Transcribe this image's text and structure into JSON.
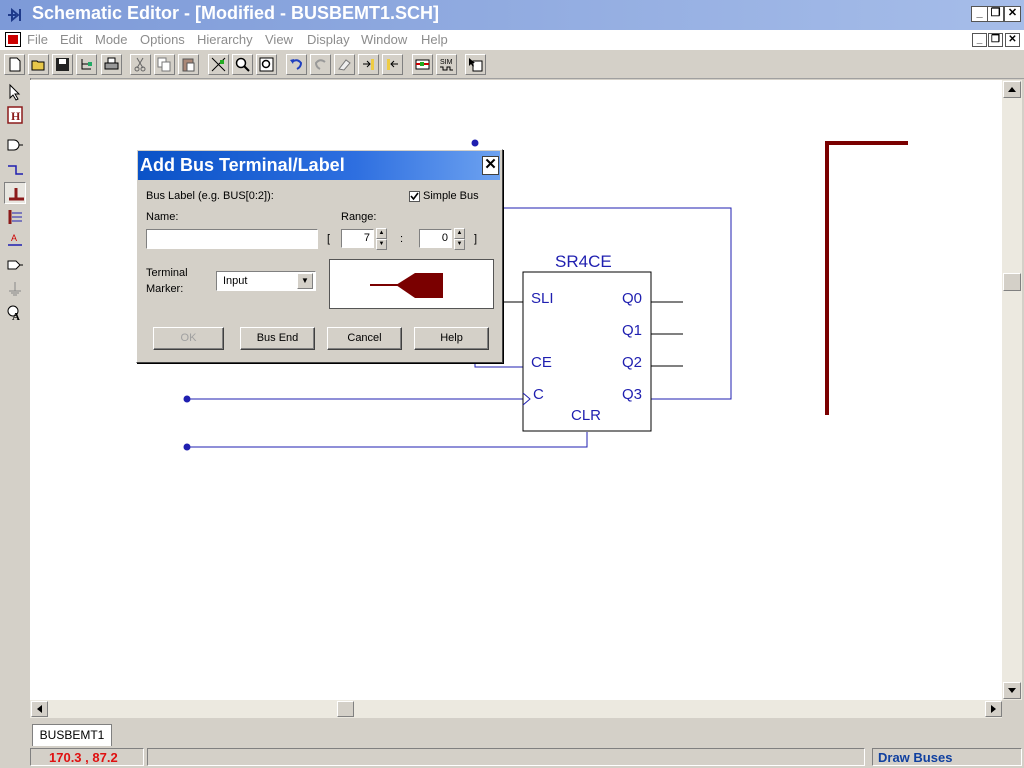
{
  "window": {
    "title": "Schematic Editor - [Modified - BUSBEMT1.SCH]",
    "minimize": "_",
    "restore": "❐",
    "close": "✕"
  },
  "menu": [
    "File",
    "Edit",
    "Mode",
    "Options",
    "Hierarchy",
    "View",
    "Display",
    "Window",
    "Help"
  ],
  "toolbar": {
    "buttons": [
      "new-icon",
      "open-icon",
      "save-icon",
      "hierarchy-icon",
      "print-icon",
      "cut-icon",
      "copy-icon",
      "paste-icon",
      "zoom-full-icon",
      "zoom-in-icon",
      "zoom-out-icon",
      "undo-icon",
      "redo-icon",
      "erase-icon",
      "push-icon",
      "pop-icon",
      "netlist-icon",
      "sim-icon",
      "help-pointer-icon"
    ],
    "sim_label": "SIM"
  },
  "palette": [
    "select-icon",
    "hierarchy-h-icon",
    "symbol-icon",
    "net-icon",
    "bus-icon",
    "bus-tap-icon",
    "label-icon",
    "io-marker-icon",
    "power-icon",
    "text-icon"
  ],
  "schematic": {
    "component_name": "SR4CE",
    "pins_left": [
      "SLI",
      "CE",
      "C",
      "CLR"
    ],
    "pins_right": [
      "Q0",
      "Q1",
      "Q2",
      "Q3"
    ],
    "wire_color": "#1f1fb0",
    "bus_color": "#7a0000"
  },
  "dialog": {
    "title": "Add Bus Terminal/Label",
    "bus_label_hint": "Bus Label (e.g. BUS[0:2]):",
    "simple_bus_label": "Simple Bus",
    "simple_bus_checked": true,
    "name_label": "Name:",
    "name_value": "",
    "range_label": "Range:",
    "range_open": "[",
    "range_from": "7",
    "range_sep": ":",
    "range_to": "0",
    "range_close": "]",
    "terminal_label_1": "Terminal",
    "terminal_label_2": "Marker:",
    "terminal_value": "Input",
    "buttons": {
      "ok": "OK",
      "bus_end": "Bus End",
      "cancel": "Cancel",
      "help": "Help"
    }
  },
  "tabs": [
    "BUSBEMT1"
  ],
  "status": {
    "coords": "170.3 ,  87.2",
    "mode": "Draw Buses"
  }
}
